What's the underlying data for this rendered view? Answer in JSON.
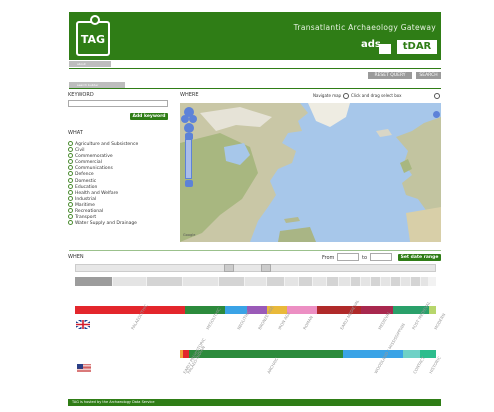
{
  "header": {
    "logo_text": "TAG",
    "site_title": "Transatlantic Archaeology Gateway",
    "partner_ads": "ads",
    "partner_tdar": "tDAR"
  },
  "nav": {
    "tab1": "about",
    "tab2": "search builder",
    "reset_label": "RESET QUERY",
    "search_label": "SEARCH"
  },
  "keyword": {
    "label": "KEYWORD",
    "placeholder": "",
    "add_label": "Add keyword"
  },
  "what": {
    "label": "WHAT",
    "items": [
      "Agriculture and Subsistence",
      "Civil",
      "Commemorative",
      "Commercial",
      "Communications",
      "Defence",
      "Domestic",
      "Education",
      "Health and Welfare",
      "Industrial",
      "Maritime",
      "Recreational",
      "Transport",
      "Water Supply and Drainage"
    ]
  },
  "where": {
    "label": "WHERE",
    "navigate_label": "Navigate map",
    "select_label": "Click and drag select box",
    "credit": "Google"
  },
  "when": {
    "label": "WHEN",
    "from_label": "From",
    "to_label": "to",
    "set_label": "Set date range",
    "uk_periods": [
      "PALAEOLITHIC",
      "MESOLITHIC",
      "NEOLITHIC",
      "BRONZE AGE",
      "IRON AGE",
      "ROMAN",
      "EARLY MEDIEVAL",
      "MEDIEVAL",
      "POST MEDIEVAL",
      "MODERN"
    ],
    "us_periods": [
      "EARLY PREHISTORIC",
      "PALAEO-INDIAN",
      "ARCHAIC",
      "WOODLAND / MISSISSIPPIAN",
      "CONTACT",
      "HISTORIC"
    ]
  },
  "colors": {
    "brand_green": "#2f7d16"
  },
  "footer": {
    "text": "TAG is hosted by the Archaeology Data Service"
  }
}
